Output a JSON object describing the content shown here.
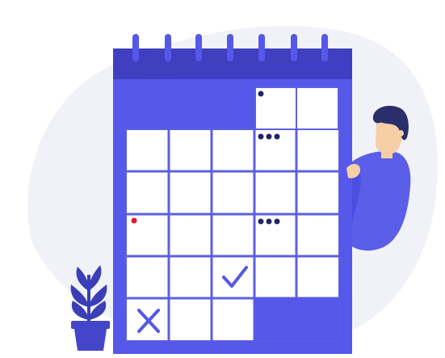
{
  "colors": {
    "primary": "#5558e8",
    "primary_dark": "#3d3fc8",
    "header": "#3f3fbf",
    "grid_lines": "#5d5fe0",
    "cell_bg": "#ffffff",
    "blob": "#f1f2f8",
    "dot_navy": "#1f2566",
    "dot_red": "#e8192c",
    "hair": "#2a2f6b",
    "skin": "#f6cfa7",
    "shirt": "#5b5ee9",
    "pot": "#4446c9",
    "plant": "#3b3eb6"
  },
  "calendar": {
    "rows": 5,
    "cols": 5,
    "marks": {
      "single_dot": "top-right-column-1",
      "triple_dot_1": "top-right-column-1-row-2",
      "triple_dot_2": "row-3-col-4",
      "red_dot": "row-3-col-1",
      "check": "row-4-col-3",
      "cross": "row-5-col-1"
    }
  },
  "icons": {
    "calendar": "calendar-icon",
    "check": "check-icon",
    "cross": "x-icon",
    "person": "person-illustration",
    "plant": "plant-illustration"
  }
}
